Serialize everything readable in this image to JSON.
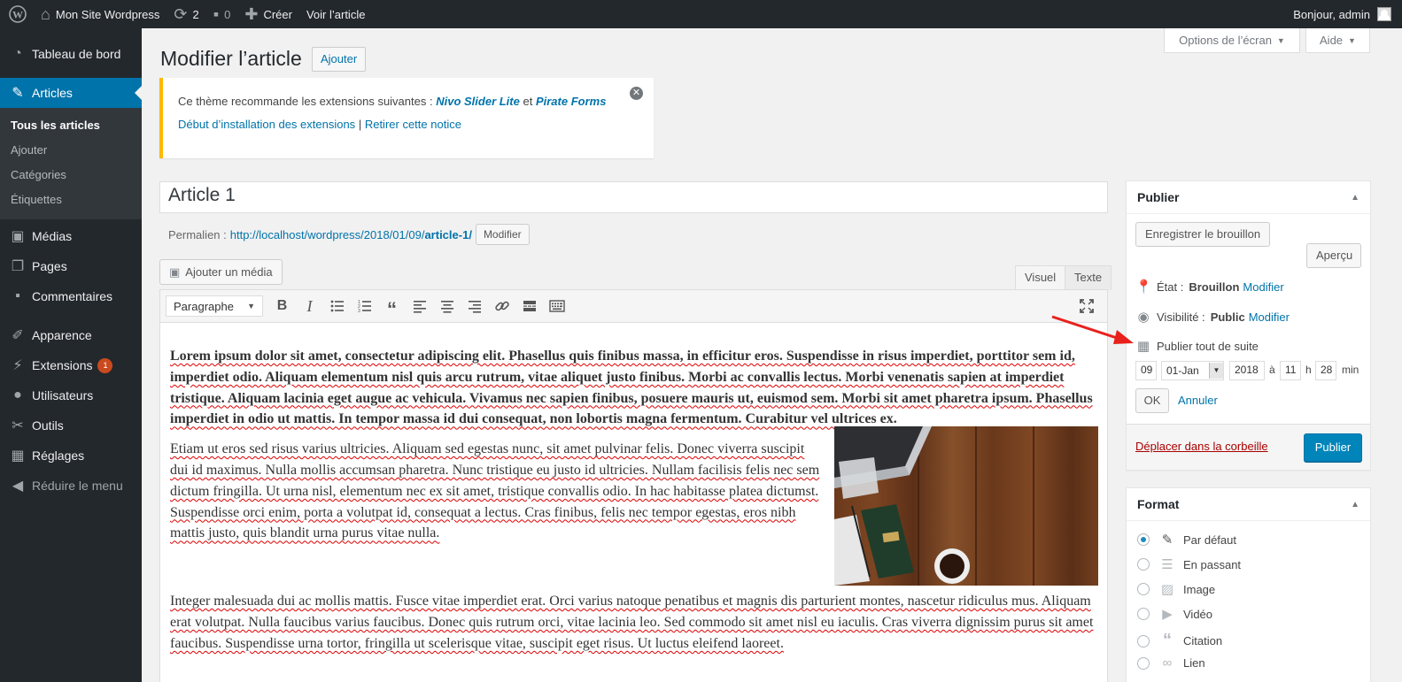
{
  "adminbar": {
    "site_name": "Mon Site Wordpress",
    "updates_count": "2",
    "comments_count": "0",
    "create_label": "Créer",
    "view_post_label": "Voir l’article",
    "greeting": "Bonjour, admin"
  },
  "sidebar": {
    "dashboard": "Tableau de bord",
    "posts": "Articles",
    "posts_sub": [
      "Tous les articles",
      "Ajouter",
      "Catégories",
      "Étiquettes"
    ],
    "media": "Médias",
    "pages": "Pages",
    "comments": "Commentaires",
    "appearance": "Apparence",
    "plugins": "Extensions",
    "plugins_badge": "1",
    "users": "Utilisateurs",
    "tools": "Outils",
    "settings": "Réglages",
    "collapse": "Réduire le menu"
  },
  "screen_meta": {
    "options_label": "Options de l’écran",
    "help_label": "Aide"
  },
  "header": {
    "title": "Modifier l’article",
    "add_new": "Ajouter"
  },
  "notice": {
    "text_before": "Ce thème recommande les extensions suivantes :",
    "plugin1": "Nivo Slider Lite",
    "conjunction": "et",
    "plugin2": "Pirate Forms",
    "install_link": "Début d’installation des extensions",
    "separator": "|",
    "dismiss_link": "Retirer cette notice"
  },
  "post": {
    "title": "Article 1",
    "permalink_label": "Permalien :",
    "permalink_base": "http://localhost/wordpress/2018/01/09/",
    "permalink_slug": "article-1/",
    "permalink_edit": "Modifier"
  },
  "editor": {
    "add_media": "Ajouter un média",
    "tab_visual": "Visuel",
    "tab_text": "Texte",
    "format_select": "Paragraphe",
    "paragraphs": [
      "Lorem ipsum dolor sit amet, consectetur adipiscing elit. Phasellus quis finibus massa, in efficitur eros. Suspendisse in risus imperdiet, porttitor sem id, imperdiet odio. Aliquam elementum nisl quis arcu rutrum, vitae aliquet justo finibus. Morbi ac convallis lectus. Morbi venenatis sapien at imperdiet tristique. Aliquam lacinia eget augue ac vehicula. Vivamus nec sapien finibus, posuere mauris ut, euismod sem. Morbi sit amet pharetra ipsum. Phasellus imperdiet in odio ut mattis. In tempor massa id dui consequat, non lobortis magna fermentum. Curabitur vel ultrices ex.",
      "Etiam ut eros sed risus varius ultricies. Aliquam sed egestas nunc, sit amet pulvinar felis. Donec viverra suscipit dui id maximus. Nulla mollis accumsan pharetra. Nunc tristique eu justo id ultricies. Nullam facilisis felis nec sem dictum fringilla. Ut urna nisl, elementum nec ex sit amet, tristique convallis odio. In hac habitasse platea dictumst. Suspendisse orci enim, porta a volutpat id, consequat a lectus. Cras finibus, felis nec tempor  egestas, eros nibh mattis justo, quis blandit urna purus vitae nulla.",
      "Integer malesuada dui ac mollis mattis. Fusce vitae imperdiet erat. Orci varius natoque penatibus et magnis dis parturient montes, nascetur ridiculus mus. Aliquam erat volutpat. Nulla faucibus varius faucibus. Donec quis rutrum orci, vitae lacinia leo. Sed commodo sit amet nisl eu iaculis. Cras viverra dignissim purus sit amet faucibus. Suspendisse urna tortor, fringilla ut scelerisque vitae, suscipit eget risus. Ut luctus eleifend laoreet."
    ]
  },
  "publish_box": {
    "title": "Publier",
    "save_draft": "Enregistrer le brouillon",
    "preview": "Aperçu",
    "status_label": "État :",
    "status_value": "Brouillon",
    "status_edit": "Modifier",
    "visibility_label": "Visibilité :",
    "visibility_value": "Public",
    "visibility_edit": "Modifier",
    "publish_time": "Publier tout de suite",
    "day": "09",
    "month": "01-Jan",
    "year": "2018",
    "at": "à",
    "hour": "11",
    "h": "h",
    "minute": "28",
    "min": "min",
    "ok": "OK",
    "cancel": "Annuler",
    "trash": "Déplacer dans la corbeille",
    "publish": "Publier"
  },
  "format_box": {
    "title": "Format",
    "options": [
      "Par défaut",
      "En passant",
      "Image",
      "Vidéo",
      "Citation",
      "Lien"
    ],
    "selected": "Par défaut"
  },
  "colors": {
    "admin_bar": "#23282d",
    "accent": "#0073aa",
    "publish_button": "#0085ba",
    "notice_border": "#ffb900",
    "arrow": "#e8211c"
  }
}
